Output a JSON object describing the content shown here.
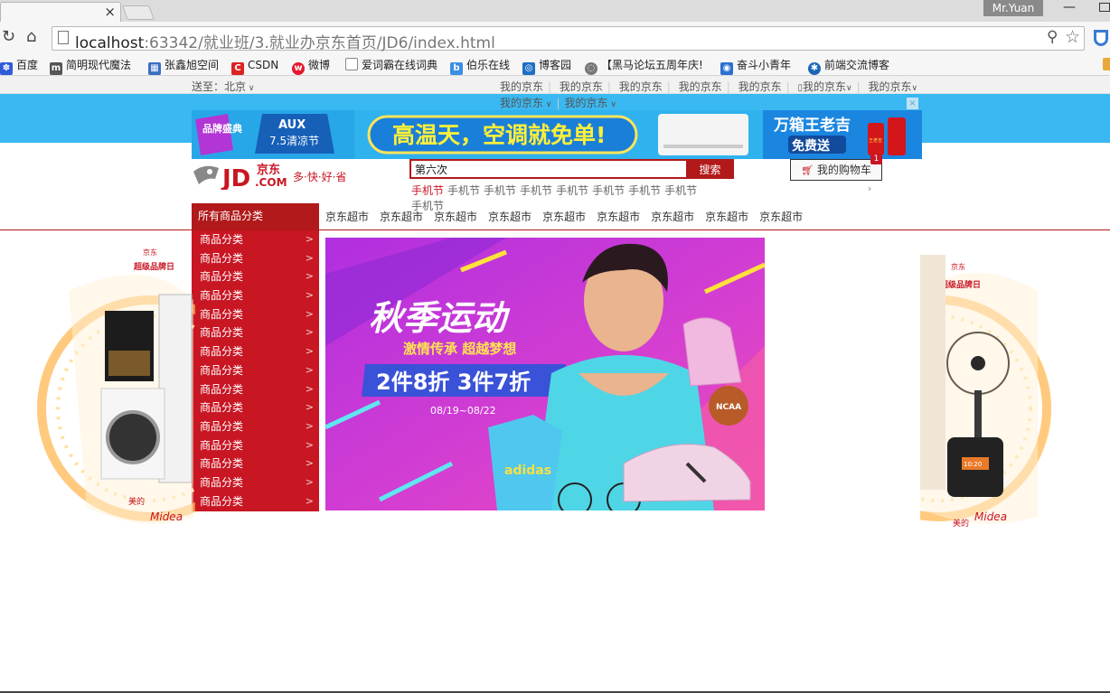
{
  "browser": {
    "tab_close": "×",
    "user": "Mr.Yuan",
    "url_host": "localhost",
    "url_path": ":63342/就业班/3.就业办京东首页/JD6/index.html",
    "bookmarks": [
      "百度",
      "简明现代魔法",
      "张鑫旭空间",
      "CSDN",
      "微博",
      "爱词霸在线词典",
      "伯乐在线",
      "博客园",
      "【黑马论坛五周年庆!",
      "奋斗小青年",
      "前端交流博客"
    ]
  },
  "topnav": {
    "address": "送至：北京",
    "links": [
      "我的京东",
      "我的京东",
      "我的京东",
      "我的京东",
      "我的京东",
      "我的京东",
      "我的京东"
    ],
    "links_row2": [
      "我的京东",
      "我的京东"
    ]
  },
  "banner": {
    "badge": "品牌盛典",
    "aux_brand": "AUX",
    "aux_event": "7.5清凉节",
    "headline": "高温天，空调就免单!",
    "promo_line1": "万箱王老吉",
    "promo_line2": "免费送",
    "can_label": "王老吉",
    "close": "×"
  },
  "logo": {
    "jd": "JD",
    "jingdong": "京东",
    "com": ".COM",
    "slogan": "多·快·好·省"
  },
  "search": {
    "value": "第六次",
    "button": "搜索"
  },
  "hotwords": [
    "手机节",
    "手机节",
    "手机节",
    "手机节",
    "手机节",
    "手机节",
    "手机节",
    "手机节",
    "手机节"
  ],
  "cart": {
    "label": "我的购物车",
    "count": "1"
  },
  "category_header": "所有商品分类",
  "nav_links": [
    "京东超市",
    "京东超市",
    "京东超市",
    "京东超市",
    "京东超市",
    "京东超市",
    "京东超市",
    "京东超市",
    "京东超市"
  ],
  "categories": [
    "商品分类",
    "商品分类",
    "商品分类",
    "商品分类",
    "商品分类",
    "商品分类",
    "商品分类",
    "商品分类",
    "商品分类",
    "商品分类",
    "商品分类",
    "商品分类",
    "商品分类",
    "商品分类",
    "商品分类"
  ],
  "hero": {
    "title": "秋季运动",
    "subtitle": "激情传承 超越梦想",
    "offer": "2件8折 3件7折",
    "dates": "08/19~08/22",
    "shirt_brand": "adidas",
    "ball": "NCAA"
  },
  "side_ads": {
    "badge": "京东",
    "badge_sub": "超级品牌日",
    "brand_cn": "美的",
    "brand_en": "Midea",
    "cooker_display": "10:20"
  },
  "colors": {
    "jd_red": "#c81623",
    "banner_blue": "#3ab8f1",
    "search_red": "#b1191a"
  }
}
